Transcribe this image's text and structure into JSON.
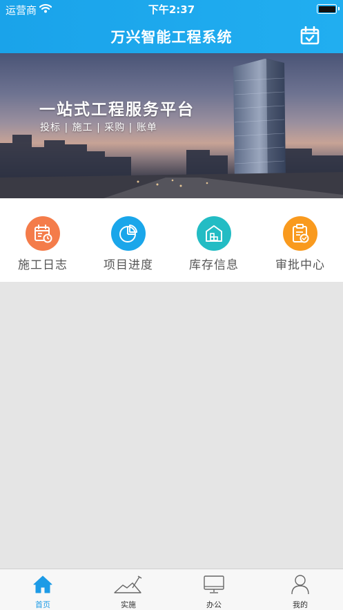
{
  "status_bar": {
    "carrier": "运营商",
    "time": "下午2:37"
  },
  "header": {
    "title": "万兴智能工程系统",
    "right_icon": "calendar-check-icon"
  },
  "banner": {
    "title": "一站式工程服务平台",
    "subtitle": "投标 | 施工 | 采购 | 账单"
  },
  "menu": {
    "items": [
      {
        "label": "施工日志",
        "icon": "construction-log-icon",
        "color": "#f47c4a"
      },
      {
        "label": "项目进度",
        "icon": "pie-chart-icon",
        "color": "#1aa6ea"
      },
      {
        "label": "库存信息",
        "icon": "warehouse-icon",
        "color": "#23bcc4"
      },
      {
        "label": "审批中心",
        "icon": "approval-clipboard-icon",
        "color": "#f99a1e"
      }
    ]
  },
  "tabbar": {
    "active": "首页",
    "items": [
      {
        "label": "首页",
        "icon": "home-icon"
      },
      {
        "label": "实施",
        "icon": "construction-site-icon"
      },
      {
        "label": "办公",
        "icon": "monitor-icon"
      },
      {
        "label": "我的",
        "icon": "user-icon"
      }
    ]
  },
  "colors": {
    "header": "#1aa3ea",
    "accent": "#1d9be6",
    "page_background": "#e5e5e5"
  }
}
